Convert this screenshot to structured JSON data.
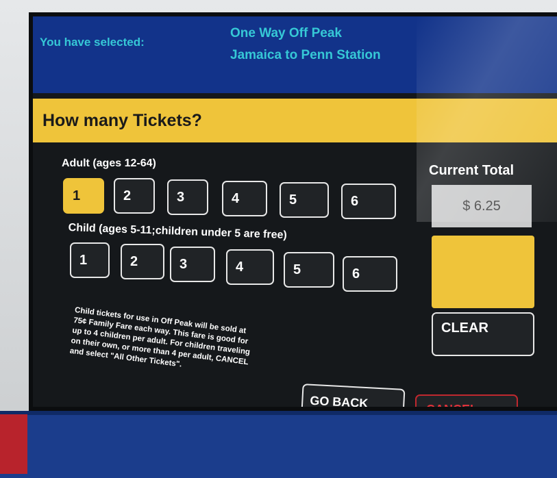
{
  "header": {
    "selected_label": "You have selected:",
    "fare_type": "One Way Off Peak",
    "route": "Jamaica to Penn Station"
  },
  "question": "How many Tickets?",
  "adult": {
    "label": "Adult (ages 12-64)",
    "options": [
      "1",
      "2",
      "3",
      "4",
      "5",
      "6"
    ],
    "selected": "1"
  },
  "child": {
    "label": "Child (ages 5-11;children under 5 are free)",
    "options": [
      "1",
      "2",
      "3",
      "4",
      "5",
      "6"
    ]
  },
  "total": {
    "label": "Current Total",
    "value": "$ 6.25"
  },
  "buttons": {
    "clear": "CLEAR",
    "go_back": "GO BACK",
    "cancel": "CANCEL"
  },
  "info_text": "Child tickets for use in Off Peak will be sold at 75¢ Family Fare each way. This fare is good for up to 4 children per adult. For children traveling on their own, or more than 4 per adult, CANCEL and select \"All Other Tickets\".",
  "colors": {
    "header_bg": "#12338a",
    "accent_yellow": "#efc43a",
    "header_text": "#36c8d6",
    "cancel_red": "#c0282e"
  }
}
